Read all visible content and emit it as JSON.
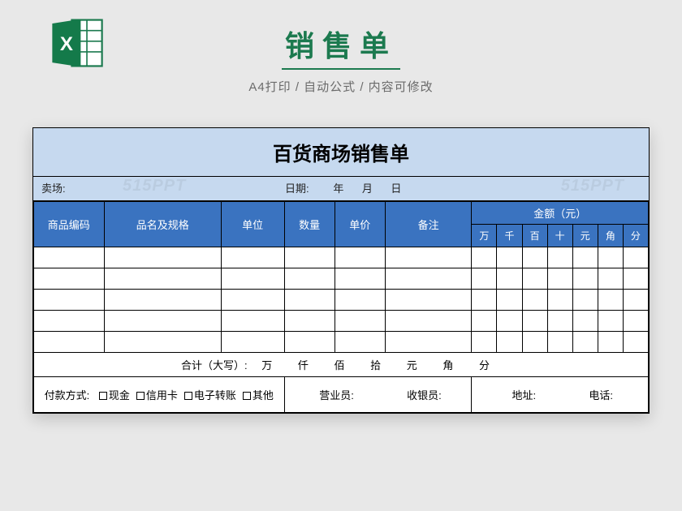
{
  "header": {
    "title": "销售单",
    "subtitle": "A4打印 / 自动公式 / 内容可修改",
    "icon": "excel-icon"
  },
  "watermark": "515PPT",
  "sheet": {
    "doc_title": "百货商场销售单",
    "field_store_label": "卖场:",
    "field_date_label": "日期:",
    "date_units": {
      "year": "年",
      "month": "月",
      "day": "日"
    },
    "columns": {
      "code": "商品编码",
      "name": "品名及规格",
      "unit": "单位",
      "qty": "数量",
      "price": "单价",
      "remark": "备注",
      "amount_group": "金额（元）",
      "amount_sub": [
        "万",
        "千",
        "百",
        "十",
        "元",
        "角",
        "分"
      ]
    },
    "data_rows": 5,
    "total": {
      "label": "合计（大写）:",
      "units": [
        "万",
        "仟",
        "佰",
        "拾",
        "元",
        "角",
        "分"
      ]
    },
    "footer": {
      "pay_label": "付款方式:",
      "pay_options": [
        "现金",
        "信用卡",
        "电子转账",
        "其他"
      ],
      "sales_label": "营业员:",
      "cashier_label": "收银员:",
      "addr_label": "地址:",
      "phone_label": "电话:"
    }
  }
}
